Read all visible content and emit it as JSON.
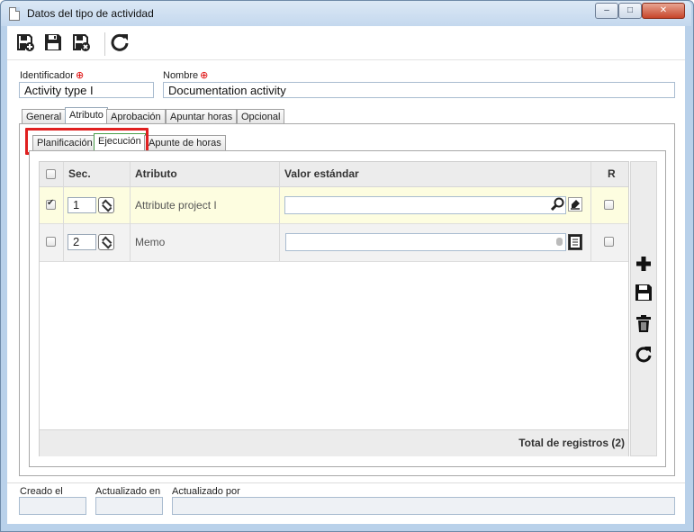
{
  "window": {
    "title": "Datos del tipo de actividad",
    "controls": {
      "minimize": "–",
      "maximize": "□",
      "close": "✕"
    }
  },
  "toolbar": {
    "icons": [
      "save-new-icon",
      "save-icon",
      "save-close-icon",
      "refresh-icon"
    ]
  },
  "form": {
    "identificador_label": "Identificador",
    "identificador_value": "Activity type I",
    "nombre_label": "Nombre",
    "nombre_value": "Documentation activity",
    "required_marker": "⊕"
  },
  "main_tabs": [
    {
      "label": "General",
      "active": false
    },
    {
      "label": "Atributo",
      "active": true
    },
    {
      "label": "Aprobación",
      "active": false
    },
    {
      "label": "Apuntar horas",
      "active": false
    },
    {
      "label": "Opcional",
      "active": false
    }
  ],
  "sub_tabs": [
    {
      "label": "Planificación",
      "active": false
    },
    {
      "label": "Ejecución",
      "active": true
    },
    {
      "label": "Apunte de horas",
      "active": false
    }
  ],
  "grid": {
    "columns": {
      "seq": "Sec.",
      "attribute": "Atributo",
      "default_value": "Valor estándar",
      "r": "R"
    },
    "rows": [
      {
        "checked": true,
        "seq": "1",
        "attribute": "Attribute project I",
        "value": "",
        "r": false,
        "tools": [
          "search-icon",
          "clear-icon"
        ]
      },
      {
        "checked": false,
        "seq": "2",
        "attribute": "Memo",
        "value": "",
        "r": false,
        "tools": [
          "memo-icon"
        ]
      }
    ],
    "total_label": "Total de registros (2)",
    "side_icons": [
      "add-icon",
      "save-icon",
      "delete-icon",
      "refresh-icon"
    ]
  },
  "footer": {
    "created_label": "Creado el",
    "updated_on_label": "Actualizado en",
    "updated_by_label": "Actualizado por",
    "created_value": "",
    "updated_on_value": "",
    "updated_by_value": ""
  },
  "colors": {
    "highlight": "#e02020",
    "selected_row": "#fdfde0",
    "required": "#dd0000"
  }
}
